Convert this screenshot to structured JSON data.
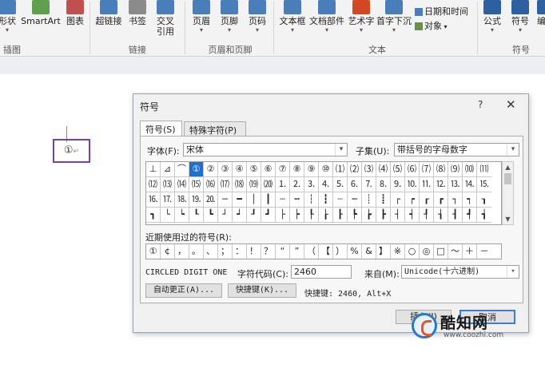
{
  "ribbon": {
    "buttons": [
      {
        "label": "形状",
        "color": "#4a7ebb"
      },
      {
        "label": "SmartArt",
        "color": "#5fa04e"
      },
      {
        "label": "图表",
        "color": "#c0504d"
      },
      {
        "label": "超链接",
        "color": "#4a7ebb"
      },
      {
        "label": "书签",
        "color": "#8b8b8b"
      },
      {
        "label": "交叉引用",
        "color": "#4a7ebb"
      },
      {
        "label": "页眉",
        "color": "#4a7ebb"
      },
      {
        "label": "页脚",
        "color": "#4a7ebb"
      },
      {
        "label": "页码",
        "color": "#4a7ebb"
      },
      {
        "label": "文本框",
        "color": "#4a7ebb"
      },
      {
        "label": "文档部件",
        "color": "#4a7ebb"
      },
      {
        "label": "艺术字",
        "color": "#d24726"
      },
      {
        "label": "首字下沉",
        "color": "#4a7ebb"
      },
      {
        "label": "公式",
        "color": "#2e5f9e"
      },
      {
        "label": "符号",
        "color": "#2e5f9e"
      },
      {
        "label": "编号",
        "color": "#2e5f9e"
      }
    ],
    "small_buttons": [
      {
        "label": "日期和时间"
      },
      {
        "label": "对象"
      }
    ],
    "groups": [
      "插图",
      "链接",
      "页眉和页脚",
      "文本",
      "符号"
    ]
  },
  "document": {
    "inserted_symbol": "①"
  },
  "dialog": {
    "title": "符号",
    "help": "?",
    "close": "✕",
    "tabs": [
      "符号(S)",
      "特殊字符(P)"
    ],
    "font_label": "字体(F):",
    "font_value": "宋体",
    "subset_label": "子集(U):",
    "subset_value": "带括号的字母数字",
    "grid_rows": [
      [
        "⊥",
        "⊿",
        "⌒",
        "①",
        "②",
        "③",
        "④",
        "⑤",
        "⑥",
        "⑦",
        "⑧",
        "⑨",
        "⑩",
        "⑴",
        "⑵",
        "⑶",
        "⑷",
        "⑸",
        "⑹",
        "⑺",
        "⑻",
        "⑼",
        "⑽",
        "⑾"
      ],
      [
        "⑿",
        "⒀",
        "⒁",
        "⒂",
        "⒃",
        "⒄",
        "⒅",
        "⒆",
        "⒇",
        "⒈",
        "⒉",
        "⒊",
        "⒋",
        "⒌",
        "⒍",
        "⒎",
        "⒏",
        "⒐",
        "⒑",
        "⒒",
        "⒓",
        "⒔",
        "⒕",
        "⒖"
      ],
      [
        "⒗",
        "⒘",
        "⒙",
        "⒚",
        "⒛",
        "─",
        "━",
        "│",
        "┃",
        "┄",
        "┅",
        "┆",
        "┇",
        "┈",
        "┉",
        "┊",
        "┋",
        "┌",
        "┍",
        "┎",
        "┏",
        "┐",
        "┑",
        "┒"
      ],
      [
        "┓",
        "└",
        "┕",
        "┖",
        "┗",
        "┘",
        "┙",
        "┚",
        "┛",
        "├",
        "┝",
        "┞",
        "┟",
        "┠",
        "┡",
        "┢",
        "┣",
        "┤",
        "┥",
        "┦",
        "┧",
        "┨",
        "┩",
        "┪"
      ]
    ],
    "selected_symbol": "①",
    "recent_label": "近期使用过的符号(R):",
    "recent_symbols": [
      "①",
      "¢",
      "，",
      "。",
      "、",
      "；",
      "：",
      "！",
      "？",
      "“",
      "”",
      "（",
      "【",
      "）",
      "%",
      "&",
      "】",
      "※",
      "○",
      "◎",
      "□",
      "～",
      "＋",
      "－"
    ],
    "char_name": "CIRCLED DIGIT ONE",
    "char_code_label": "字符代码(C):",
    "char_code_value": "2460",
    "from_label": "来自(M):",
    "from_value": "Unicode(十六进制)",
    "autocorrect_button": "自动更正(A)...",
    "shortcut_button": "快捷键(K)...",
    "shortcut_text": "快捷键: 2460, Alt+X",
    "insert_button": "插入(I)",
    "cancel_button": "取消"
  },
  "watermark": {
    "brand": "酷知网",
    "url": "www.coozhi.com"
  }
}
